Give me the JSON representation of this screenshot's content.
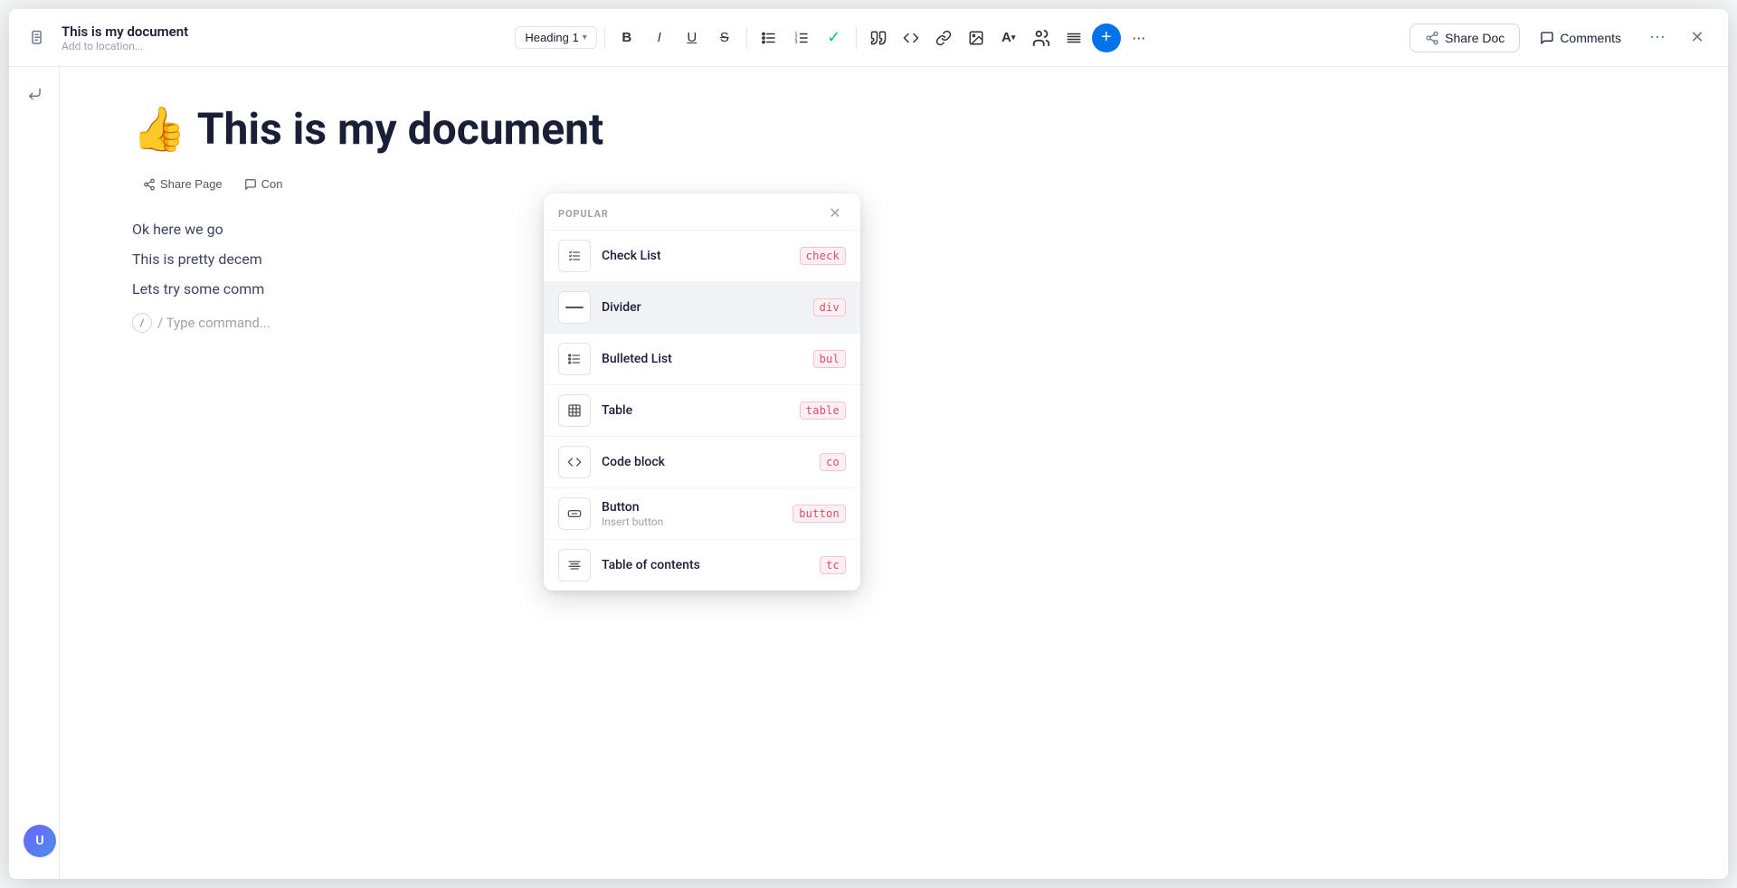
{
  "window": {
    "title": "This is my document",
    "subtitle": "Add to location..."
  },
  "toolbar": {
    "heading_label": "Heading 1",
    "bold_label": "B",
    "italic_label": "I",
    "underline_label": "U",
    "strikethrough_label": "S",
    "share_doc_label": "Share Doc",
    "comments_label": "Comments"
  },
  "document": {
    "emoji": "👍",
    "heading": "This is my document",
    "inline_buttons": [
      {
        "icon": "share",
        "label": "Share Page"
      },
      {
        "icon": "comment",
        "label": "Con"
      }
    ],
    "paragraphs": [
      "Ok here we go",
      "This is pretty decem",
      "Lets try some comm"
    ],
    "command_placeholder": "/ Type command..."
  },
  "popup": {
    "section_label": "POPULAR",
    "items": [
      {
        "name": "Check List",
        "desc": "",
        "shortcut": "check",
        "icon": "checklist"
      },
      {
        "name": "Divider",
        "desc": "",
        "shortcut": "div",
        "icon": "divider",
        "highlighted": true
      },
      {
        "name": "Bulleted List",
        "desc": "",
        "shortcut": "bul",
        "icon": "bulleted-list"
      },
      {
        "name": "Table",
        "desc": "",
        "shortcut": "table",
        "icon": "table"
      },
      {
        "name": "Code block",
        "desc": "",
        "shortcut": "co",
        "icon": "code"
      },
      {
        "name": "Button",
        "desc": "Insert button",
        "shortcut": "button",
        "icon": "button"
      },
      {
        "name": "Table of contents",
        "desc": "",
        "shortcut": "tc",
        "icon": "toc"
      }
    ]
  },
  "colors": {
    "accent_blue": "#0073ea",
    "accent_red": "#e04b6e",
    "check_green": "#00c875",
    "text_primary": "#1a1f36",
    "text_secondary": "#9ca3af"
  }
}
